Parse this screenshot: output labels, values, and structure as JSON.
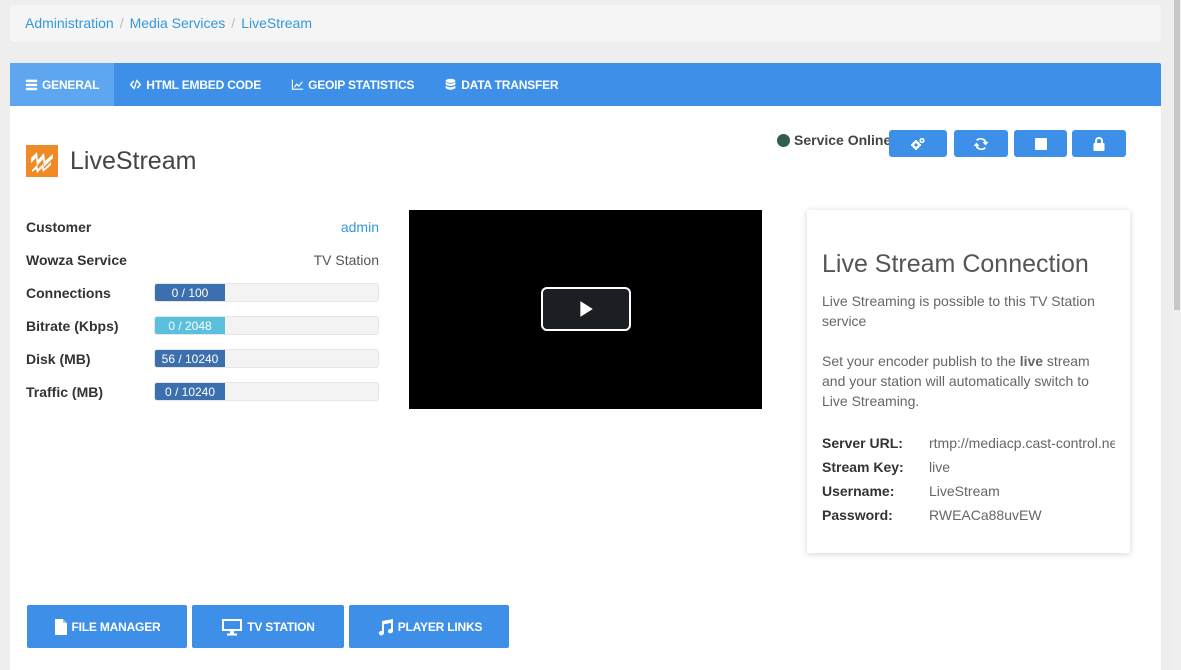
{
  "breadcrumb": {
    "items": [
      "Administration",
      "Media Services",
      "LiveStream"
    ],
    "separator": "/"
  },
  "tabs": [
    {
      "label": "GENERAL",
      "icon": "list-icon",
      "active": true
    },
    {
      "label": "HTML EMBED CODE",
      "icon": "code-icon",
      "active": false
    },
    {
      "label": "GEOIP STATISTICS",
      "icon": "chart-icon",
      "active": false
    },
    {
      "label": "DATA TRANSFER",
      "icon": "database-icon",
      "active": false
    }
  ],
  "service": {
    "title": "LiveStream",
    "logo_icon": "wowza-logo-icon",
    "status_text": "Service Online",
    "status_color": "#2e5e4e",
    "controls": [
      "settings-icon",
      "restart-icon",
      "stop-icon",
      "lock-icon"
    ]
  },
  "stats": {
    "customer": {
      "label": "Customer",
      "value": "admin"
    },
    "wowza_service": {
      "label": "Wowza Service",
      "value": "TV Station"
    },
    "connections": {
      "label": "Connections",
      "text": "0 / 100",
      "fraction": 0.0
    },
    "bitrate": {
      "label": "Bitrate (Kbps)",
      "text": "0 / 2048",
      "fraction": 0.0
    },
    "disk": {
      "label": "Disk (MB)",
      "text": "56 / 10240",
      "fraction": 0.0055
    },
    "traffic": {
      "label": "Traffic (MB)",
      "text": "0 / 10240",
      "fraction": 0.0
    }
  },
  "player": {
    "play_icon": "play-icon"
  },
  "connection": {
    "title": "Live Stream Connection",
    "intro": "Live Streaming is possible to this TV Station service",
    "instr_before": "Set your encoder publish to the ",
    "instr_bold": "live",
    "instr_after": " stream and your station will automatically switch to Live Streaming.",
    "server_url_label": "Server URL:",
    "server_url": "rtmp://mediacp.cast-control.net",
    "stream_key_label": "Stream Key:",
    "stream_key": "live",
    "username_label": "Username:",
    "username": "LiveStream",
    "password_label": "Password:",
    "password": "RWEACa88uvEW"
  },
  "actions": [
    {
      "label": "FILE MANAGER",
      "icon": "file-icon"
    },
    {
      "label": "TV STATION",
      "icon": "monitor-icon"
    },
    {
      "label": "PLAYER LINKS",
      "icon": "music-icon"
    }
  ],
  "colors": {
    "primary": "#3d8fe8",
    "active_tab": "#5ea6f0",
    "bar_dark": "#3c6fad",
    "bar_light": "#5bc0de",
    "link": "#3498db",
    "brand_orange": "#f08a24"
  }
}
